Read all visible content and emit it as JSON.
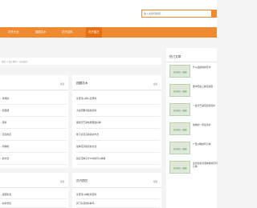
{
  "search": {
    "placeholder": "输入关键词搜索..."
  },
  "nav": {
    "items": [
      {
        "label": "花卉大全"
      },
      {
        "label": "园圃花木"
      },
      {
        "label": "花卉百科"
      },
      {
        "label": "花卉园艺",
        "active": true
      }
    ]
  },
  "breadcrumb": {
    "text": "首页 > 花卉百科 > 花卉园艺"
  },
  "panels": {
    "left_top": {
      "more": "更多",
      "items": [
        "…学成的",
        "…和延期",
        "…苗料",
        "…花卉的花",
        "…何种植",
        "…的方式"
      ]
    },
    "mid_top": {
      "title": "园圃花木",
      "more": "更多",
      "items": [
        "家里可以种火龙果吗",
        "大战河蟹养殖前途吗",
        "都说天竺葵在哪里最好种",
        "地下室花卉的养护方法",
        "盆种花卉施药的方法",
        "栽红花种子什么时候可以种植"
      ]
    },
    "left_bottom": {
      "more": "更多",
      "items": [
        "…蛋疾防治",
        "…好的长处"
      ]
    },
    "mid_bottom": {
      "title": "花卉园艺",
      "more": "更多",
      "items": [
        "家里可以种杜鹃花吗",
        "买门头花的好看吗"
      ]
    },
    "hot": {
      "title": "热门文章",
      "items": [
        {
          "thumb": "花卉园艺一鉴图",
          "title": "什么品质的鲜花作"
        },
        {
          "thumb": "花卉园艺一鉴图",
          "title": "都市阳台上种花指南"
        },
        {
          "thumb": "花卉园艺一鉴图",
          "title": "一盆天竺葵花如何养护"
        },
        {
          "thumb": "花卉园艺一鉴图",
          "title": "植物的一年生养护"
        },
        {
          "thumb": "花卉园艺一鉴图",
          "title": "广西沙糖桔有几种"
        },
        {
          "thumb": "花卉园艺一鉴图",
          "title": "适合的营养液种植的花有几种"
        }
      ]
    }
  },
  "colors": {
    "accent": "#f08a30",
    "accent_dark": "#e86f10",
    "background": "#f4f4f4"
  }
}
